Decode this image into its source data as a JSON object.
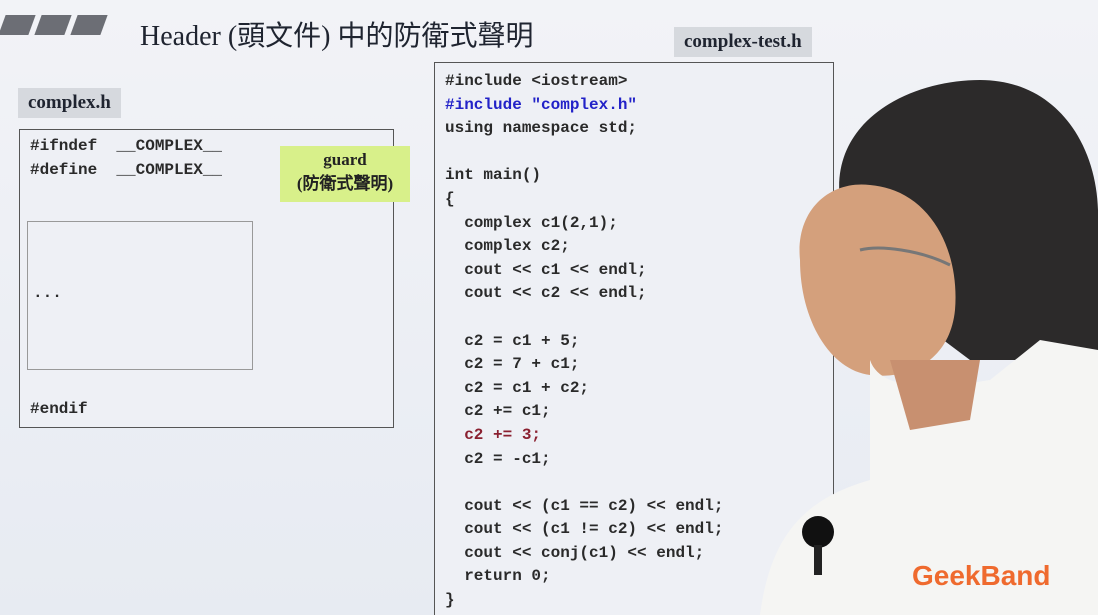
{
  "slide": {
    "title": "Header (頭文件) 中的防衛式聲明",
    "left_tag": "complex.h",
    "right_tag": "complex-test.h",
    "header_code": {
      "ifndef": "#ifndef  __COMPLEX__",
      "define": "#define  __COMPLEX__",
      "ellipsis": "...",
      "endif": "#endif"
    },
    "guard_note": {
      "line1": "guard",
      "line2": "(防衛式聲明)"
    },
    "test_code": [
      {
        "text": "#include <iostream>",
        "style": "normal"
      },
      {
        "text": "#include \"complex.h\"",
        "style": "blue"
      },
      {
        "text": "using namespace std;",
        "style": "normal"
      },
      {
        "text": "",
        "style": "normal"
      },
      {
        "text": "int main()",
        "style": "normal"
      },
      {
        "text": "{",
        "style": "normal"
      },
      {
        "text": "  complex c1(2,1);",
        "style": "normal"
      },
      {
        "text": "  complex c2;",
        "style": "normal"
      },
      {
        "text": "  cout << c1 << endl;",
        "style": "normal"
      },
      {
        "text": "  cout << c2 << endl;",
        "style": "normal"
      },
      {
        "text": "",
        "style": "normal"
      },
      {
        "text": "  c2 = c1 + 5;",
        "style": "normal"
      },
      {
        "text": "  c2 = 7 + c1;",
        "style": "normal"
      },
      {
        "text": "  c2 = c1 + c2;",
        "style": "normal"
      },
      {
        "text": "  c2 += c1;",
        "style": "normal"
      },
      {
        "text": "  c2 += 3;",
        "style": "red"
      },
      {
        "text": "  c2 = -c1;",
        "style": "normal"
      },
      {
        "text": "",
        "style": "normal"
      },
      {
        "text": "  cout << (c1 == c2) << endl;",
        "style": "normal"
      },
      {
        "text": "  cout << (c1 != c2) << endl;",
        "style": "normal"
      },
      {
        "text": "  cout << conj(c1) << endl;",
        "style": "normal"
      },
      {
        "text": "  return 0;",
        "style": "normal"
      },
      {
        "text": "}",
        "style": "normal"
      }
    ]
  },
  "watermark": "GeekBand",
  "colors": {
    "accent_blue": "#2222c8",
    "accent_red": "#8a2030",
    "guard_bg": "#d8f08a",
    "logo": "#ef6a2e"
  }
}
